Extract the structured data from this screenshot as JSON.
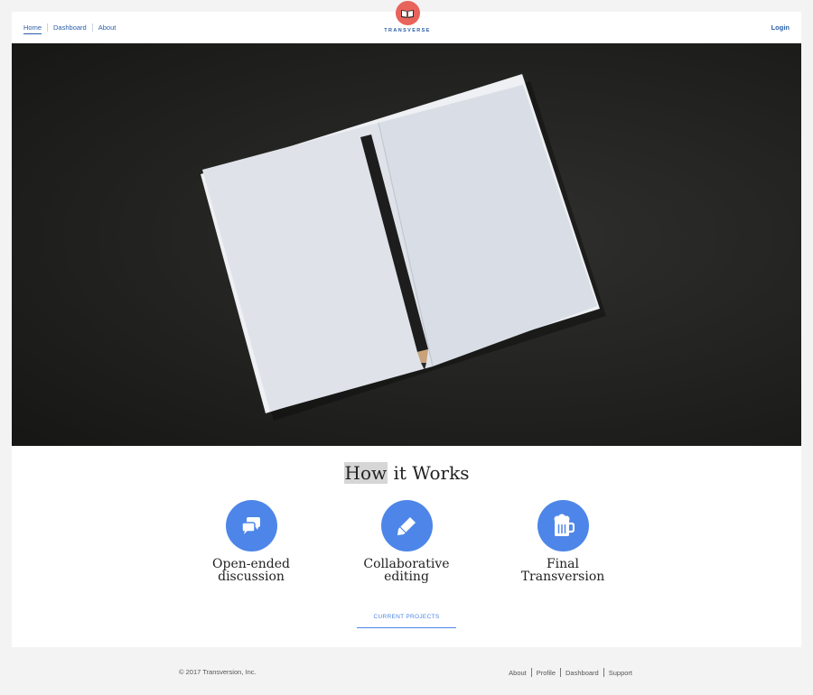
{
  "nav": {
    "links": [
      "Home",
      "Dashboard",
      "About"
    ],
    "logo_text": "TRANSVERSE",
    "login": "Login"
  },
  "hero": {
    "image": "open blank notebook with pencil on dark background"
  },
  "how_it_works": {
    "title_highlight": "How",
    "title_rest": " it Works",
    "features": [
      {
        "icon": "chat-bubbles-icon",
        "line1": "Open-ended",
        "line2": "discussion"
      },
      {
        "icon": "pencil-icon",
        "line1": "Collaborative",
        "line2": "editing"
      },
      {
        "icon": "beer-mug-icon",
        "line1": "Final",
        "line2": "Transversion"
      }
    ],
    "cta": "CURRENT PROJECTS"
  },
  "footer": {
    "copyright": "© 2017 Transversion, Inc.",
    "links": [
      "About",
      "Profile",
      "Dashboard",
      "Support"
    ]
  },
  "colors": {
    "accent": "#4d86e8",
    "link": "#2b5ea7",
    "logo": "#e8635c"
  }
}
